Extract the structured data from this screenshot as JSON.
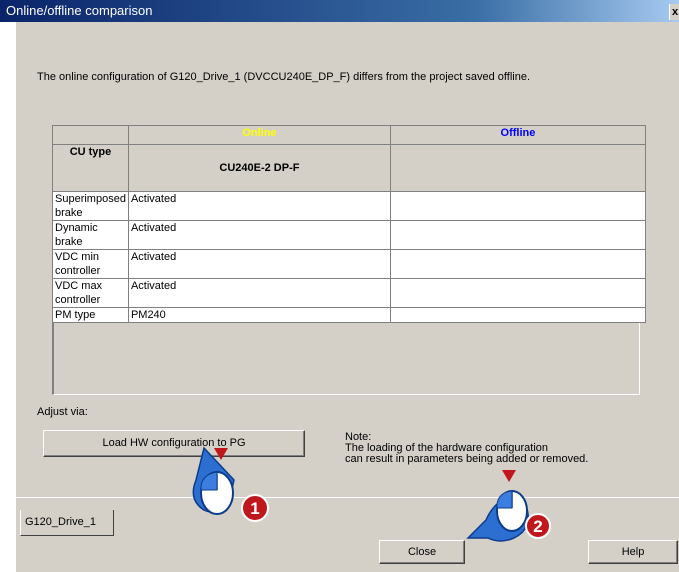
{
  "window": {
    "title": "Online/offline comparison",
    "close_glyph": "x"
  },
  "message": "The online configuration of G120_Drive_1 (DVCCU240E_DP_F) differs from the project saved offline.",
  "table": {
    "header_online": "Online",
    "header_offline": "Offline",
    "cu_label": "CU type",
    "cu_online": "CU240E-2 DP-F",
    "cu_offline": "",
    "rows": [
      {
        "label": "Superimposed brake",
        "online": "Activated",
        "offline": ""
      },
      {
        "label": "Dynamic brake",
        "online": "Activated",
        "offline": ""
      },
      {
        "label": "VDC min controller",
        "online": "Activated",
        "offline": ""
      },
      {
        "label": "VDC max controller",
        "online": "Activated",
        "offline": ""
      },
      {
        "label": "PM type",
        "online": "PM240",
        "offline": ""
      }
    ]
  },
  "adjust_label": "Adjust via:",
  "load_button": "Load HW configuration to PG",
  "note": "Note:\nThe loading of the hardware configuration\ncan result in parameters being added or removed.",
  "tab": "G120_Drive_1",
  "close_button": "Close",
  "help_button": "Help",
  "callouts": [
    {
      "number": "1"
    },
    {
      "number": "2"
    }
  ],
  "colors": {
    "online_header": "#ffff00",
    "offline_header": "#0000ff",
    "callout_blue": "#2d6fd0",
    "callout_red": "#c0171d"
  }
}
